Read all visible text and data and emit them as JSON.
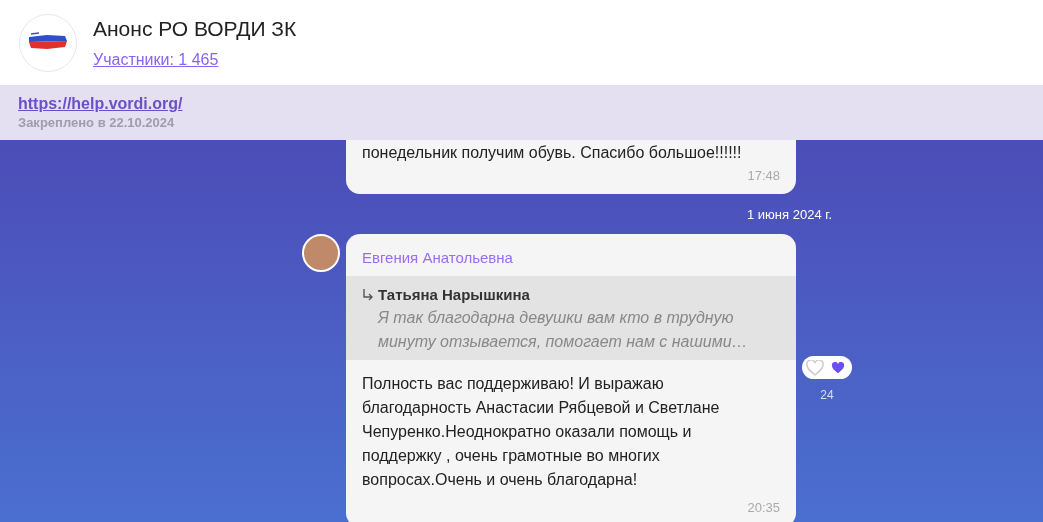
{
  "header": {
    "title": "Анонс РО ВОРДИ ЗК",
    "members_link": "Участники: 1 465"
  },
  "pinned": {
    "link": "https://help.vordi.org/",
    "caption": "Закреплено в 22.10.2024"
  },
  "messages": [
    {
      "kind": "plain",
      "text": "понедельник получим обувь. Спасибо большое!!!!!!",
      "time": "17:48"
    },
    {
      "kind": "date",
      "text": "1 июня 2024 г."
    },
    {
      "kind": "reply",
      "author": "Евгения Анатольевна",
      "quote_author": "Татьяна Нарышкина",
      "quote_text": "Я так благодарна девушки вам кто в трудную минуту отзывается, помогает нам с нашими…",
      "text": "Полность вас поддерживаю! И выражаю благодарность Анастасии Рябцевой и Светлане Чепуренко.Неоднократно оказали помощь и поддержку , очень грамотные во многих вопросах.Очень и очень благодарна!",
      "time": "20:35",
      "reaction_count": "24"
    }
  ]
}
